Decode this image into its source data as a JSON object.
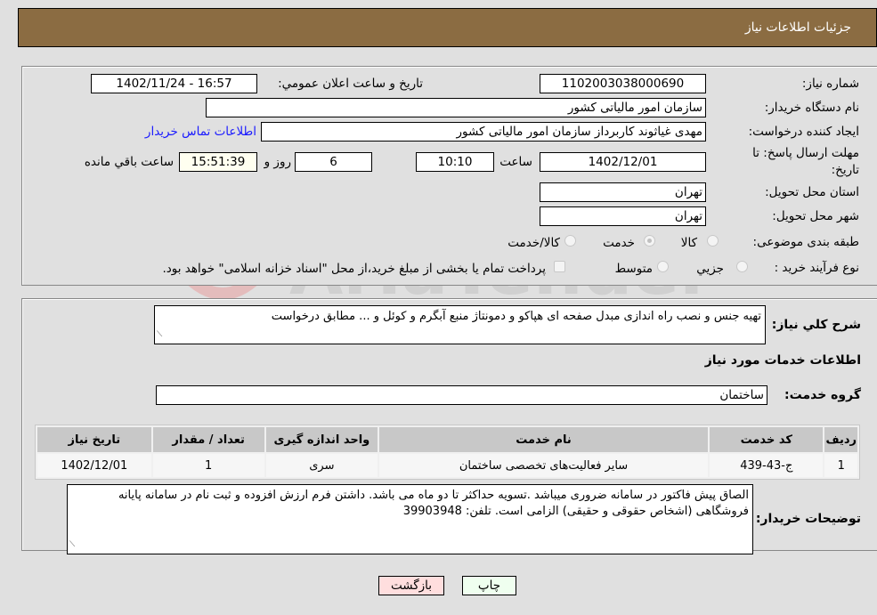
{
  "header": {
    "title": "جزئیات اطلاعات نیاز"
  },
  "form": {
    "need_number": {
      "label": "شماره نیاز:",
      "value": "1102003038000690"
    },
    "announce_datetime": {
      "label": "تاريخ و ساعت اعلان عمومي:",
      "value": "1402/11/24 - 16:57"
    },
    "buyer_org": {
      "label": "نام دستگاه خريدار:",
      "value": "سازمان امور مالیاتی کشور"
    },
    "requester": {
      "label": "ايجاد كننده درخواست:",
      "value": "مهدی غیاثوند کاربرداز سازمان امور مالیاتی کشور"
    },
    "buyer_contact_link": "اطلاعات تماس خريدار",
    "deadline": {
      "label_line1": "مهلت ارسال پاسخ: تا",
      "label_line2": "تاريخ:",
      "date": "1402/12/01",
      "time_label": "ساعت",
      "time": "10:10",
      "days": "6",
      "days_label": "روز و",
      "remaining": "15:51:39",
      "remaining_label": "ساعت باقي مانده"
    },
    "province": {
      "label": "استان محل تحويل:",
      "value": "تهران"
    },
    "city": {
      "label": "شهر محل تحويل:",
      "value": "تهران"
    },
    "category": {
      "label": "طبقه بندی موضوعی:",
      "options": [
        {
          "label": "کالا",
          "checked": false
        },
        {
          "label": "خدمت",
          "checked": true
        },
        {
          "label": "کالا/خدمت",
          "checked": false
        }
      ]
    },
    "purchase_type": {
      "label": "نوع فرآيند خريد :",
      "options": [
        {
          "label": "جزيي",
          "checked": false
        },
        {
          "label": "متوسط",
          "checked": false
        }
      ],
      "treasury_note": "پرداخت تمام يا بخشی از مبلغ خريد،از محل \"اسناد خزانه اسلامی\" خواهد بود."
    }
  },
  "details": {
    "summary_label": "شرح كلي نياز:",
    "summary_value": "تهیه جنس و نصب راه اندازی مبدل صفحه ای هپاکو و دمونتاژ منبع آبگرم و کوئل و ... مطابق درخواست",
    "services_heading": "اطلاعات خدمات مورد نياز",
    "service_group_label": "گروه خدمت:",
    "service_group_value": "ساختمان",
    "table": {
      "headers": [
        "رديف",
        "كد خدمت",
        "نام خدمت",
        "واحد اندازه گيری",
        "تعداد / مقدار",
        "تاريخ نياز"
      ],
      "rows": [
        [
          "1",
          "ج-43-439",
          "ساير فعاليت‌های تخصصی ساختمان",
          "سری",
          "1",
          "1402/12/01"
        ]
      ]
    },
    "buyer_notes_label": "توضيحات خريدار:",
    "buyer_notes_value": "الصاق پیش فاکتور در سامانه ضروری میباشد .تسویه حداکثر تا دو ماه می باشد.  داشتن فرم ارزش افزوده و ثبت نام در سامانه پایانه فروشگاهی (اشخاص حقوقی و حقیقی) الزامی است. تلفن:  39903948"
  },
  "buttons": {
    "print": "چاپ",
    "back": "بازگشت"
  },
  "colors": {
    "header_bg": "#8b6c42",
    "link": "#1a1aff",
    "print_bg": "#efffef",
    "back_bg": "#ffdede",
    "remaining_bg": "#fffff0"
  }
}
